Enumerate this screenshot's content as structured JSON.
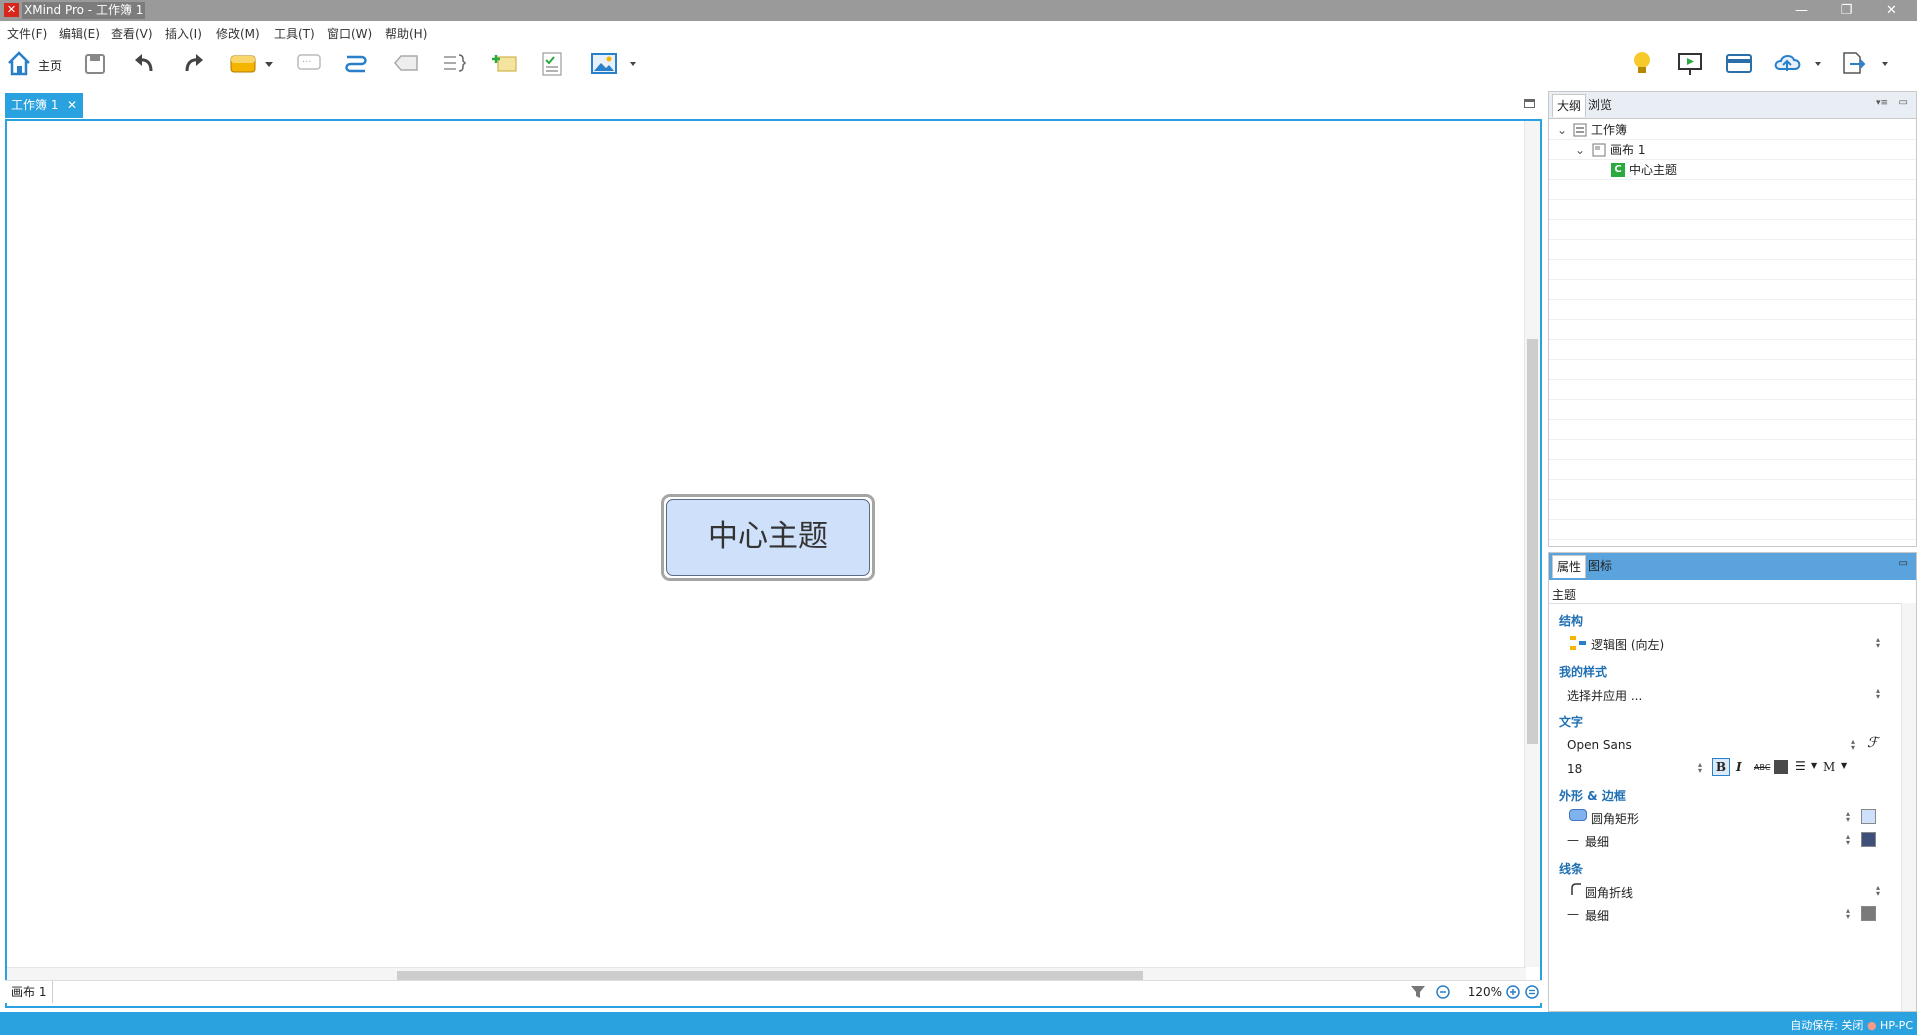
{
  "window": {
    "title": "XMind Pro - 工作簿 1",
    "logo": "✕",
    "controls": {
      "minimize": "—",
      "restore": "❐",
      "close": "✕"
    }
  },
  "menu": [
    "文件(F)",
    "编辑(E)",
    "查看(V)",
    "插入(I)",
    "修改(M)",
    "工具(T)",
    "窗口(W)",
    "帮助(H)"
  ],
  "toolbar": {
    "home_label": "主页",
    "icons": [
      "home-icon",
      "save-icon",
      "undo-icon",
      "redo-icon",
      "topic-icon",
      "callout-icon",
      "relationship-icon",
      "boundary-icon",
      "summary-icon",
      "note-icon",
      "task-icon",
      "image-icon",
      "idea-icon",
      "presentation-icon",
      "share-icon",
      "upload-icon",
      "export-icon"
    ]
  },
  "editor": {
    "tab_label": "工作簿 1",
    "tab_close": "✕",
    "central_topic": "中心主题",
    "sheet_tab": "画布 1",
    "zoom": "120%"
  },
  "outline": {
    "tabs": [
      "大纲",
      "浏览"
    ],
    "items": [
      {
        "label": "工作簿",
        "expander": "⌄"
      },
      {
        "label": "画布 1",
        "expander": "⌄"
      },
      {
        "label": "中心主题",
        "badge": "C"
      }
    ]
  },
  "properties": {
    "tabs": [
      "属性",
      "图标"
    ],
    "subject": "主题",
    "sections": {
      "structure": {
        "title": "结构",
        "value": "逻辑图 (向左)"
      },
      "my_style": {
        "title": "我的样式",
        "value": "选择并应用 ..."
      },
      "text": {
        "title": "文字",
        "font": "Open Sans",
        "size": "18",
        "bold": "B",
        "italic": "I",
        "strike": "ABC",
        "m_label": "M"
      },
      "shape": {
        "title": "外形 & 边框",
        "shape": "圆角矩形",
        "border": "最细"
      },
      "line": {
        "title": "线条",
        "line_type": "圆角折线",
        "line_width": "最细"
      }
    },
    "colors": {
      "fill": "#cfe0fb",
      "border": "#3d4f7a",
      "line": "#7a7a7a",
      "text": "#4a4a4a"
    }
  },
  "status": {
    "autosave": "自动保存: 关闭",
    "user": "HP-PC"
  },
  "colors": {
    "accent": "#2aa2df",
    "topic_fill": "#cfe0fb"
  }
}
